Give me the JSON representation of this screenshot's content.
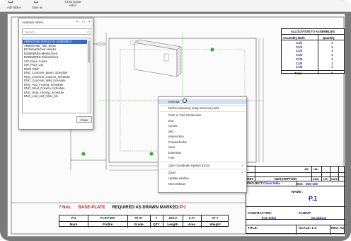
{
  "toolbar": {
    "items": [
      "Add tables",
      "Save as",
      "Close layout editor"
    ]
  },
  "dialog": {
    "title": "Available tables",
    "minimize": "–",
    "maximize": "□",
    "close": "×",
    "search_placeholder": "Search...",
    "items": [
      "AB6000 ME SINGLE IN ASSEMBLY",
      "AB6000 ME_Title_Block",
      "BS-RebarSched-Header",
      "BS8666RBS-MeshSched",
      "BS8666RBS-RebarSched",
      "CIP_Pour_Colors",
      "CIP_Pour_List",
      "DWG-DWF",
      "ENG_Concrete_Beam_Schedule",
      "ENG_Concrete_Column_Schedule",
      "ENG_Concrete_Wall_Schedule",
      "ENG_Pad_Footing_Schedule",
      "ENG_Steel_Column_Schedule",
      "ENG_Strip_Footing_Schedule",
      "ENG_cast_unit_rebar_list"
    ],
    "close_button": "Close"
  },
  "context_menu": {
    "items": [
      {
        "label": "Interrupt",
        "highlighted": true
      },
      {
        "label": "Define temporary snap reference point"
      },
      {
        "label": "Point or Grid Intersection"
      },
      {
        "label": "End"
      },
      {
        "label": "Center"
      },
      {
        "label": "Mid"
      },
      {
        "label": "Intersection"
      },
      {
        "label": "Perpendicular"
      },
      {
        "label": "Near"
      },
      {
        "label": "Extension"
      },
      {
        "label": "Free"
      },
      {
        "label": "User Coordinate System (UCS)",
        "submenu": true
      },
      {
        "label": "Zoom",
        "submenu": true
      },
      {
        "label": "Update window"
      },
      {
        "label": "Next window"
      }
    ],
    "arrow": "›"
  },
  "allocation": {
    "title": "ALLOCATION TO ASSEMBLIES",
    "col_mark": "Assembly Mark",
    "col_qty": "Quantity",
    "rows": [
      {
        "mark": "C1/1",
        "qty": "1"
      },
      {
        "mark": "C1/2",
        "qty": "1"
      },
      {
        "mark": "C1/3",
        "qty": "1"
      },
      {
        "mark": "C1/4",
        "qty": "1"
      },
      {
        "mark": "C1/5",
        "qty": "1"
      },
      {
        "mark": "C1/6",
        "qty": "1"
      },
      {
        "mark": "C1/8",
        "qty": "1"
      }
    ],
    "total_label": "Total",
    "total_value": "7"
  },
  "title_block": {
    "rev": "REV",
    "description": "DESCRIPTION",
    "dwn": "DWN",
    "chk": "CHK",
    "date": "DATE",
    "ab": "AB",
    "ub": "UB",
    "project_label": "PROJECT:",
    "project_value": "Class tekla",
    "no_label": "NO:",
    "no_value": "500-103",
    "name_label": "NAME :",
    "name_value": "P.1",
    "contractor_label": "CONTRACTOR:",
    "contractor_value": "Iran tekla",
    "client_label": "CLIENT:",
    "client_value": "Mr.abbasi",
    "title_label": "TITLE:",
    "scale_label": "SCALE: 1:5",
    "rev2_label": "REV:",
    "rev2_value": "A4"
  },
  "parts": {
    "count": "7 Nos.",
    "name": "BASE-PLATE",
    "note": "REQUIRED AS DRAWN MARKED:",
    "mark_ref": "P/1",
    "values": [
      "P/1",
      "PL30*400",
      "St-37",
      "7",
      "400.0",
      "0.37",
      "37.7"
    ],
    "headers": [
      "Mark",
      "Profile",
      "Grade",
      "QTY",
      "Length",
      "Area",
      "Weight"
    ]
  },
  "colors": {
    "highlight": "#2a6cd8",
    "menu_hover": "#cfe0f6",
    "blue_text": "#1a1aa8",
    "red_text": "#c81e1e",
    "line_green": "#3aaa3a"
  }
}
